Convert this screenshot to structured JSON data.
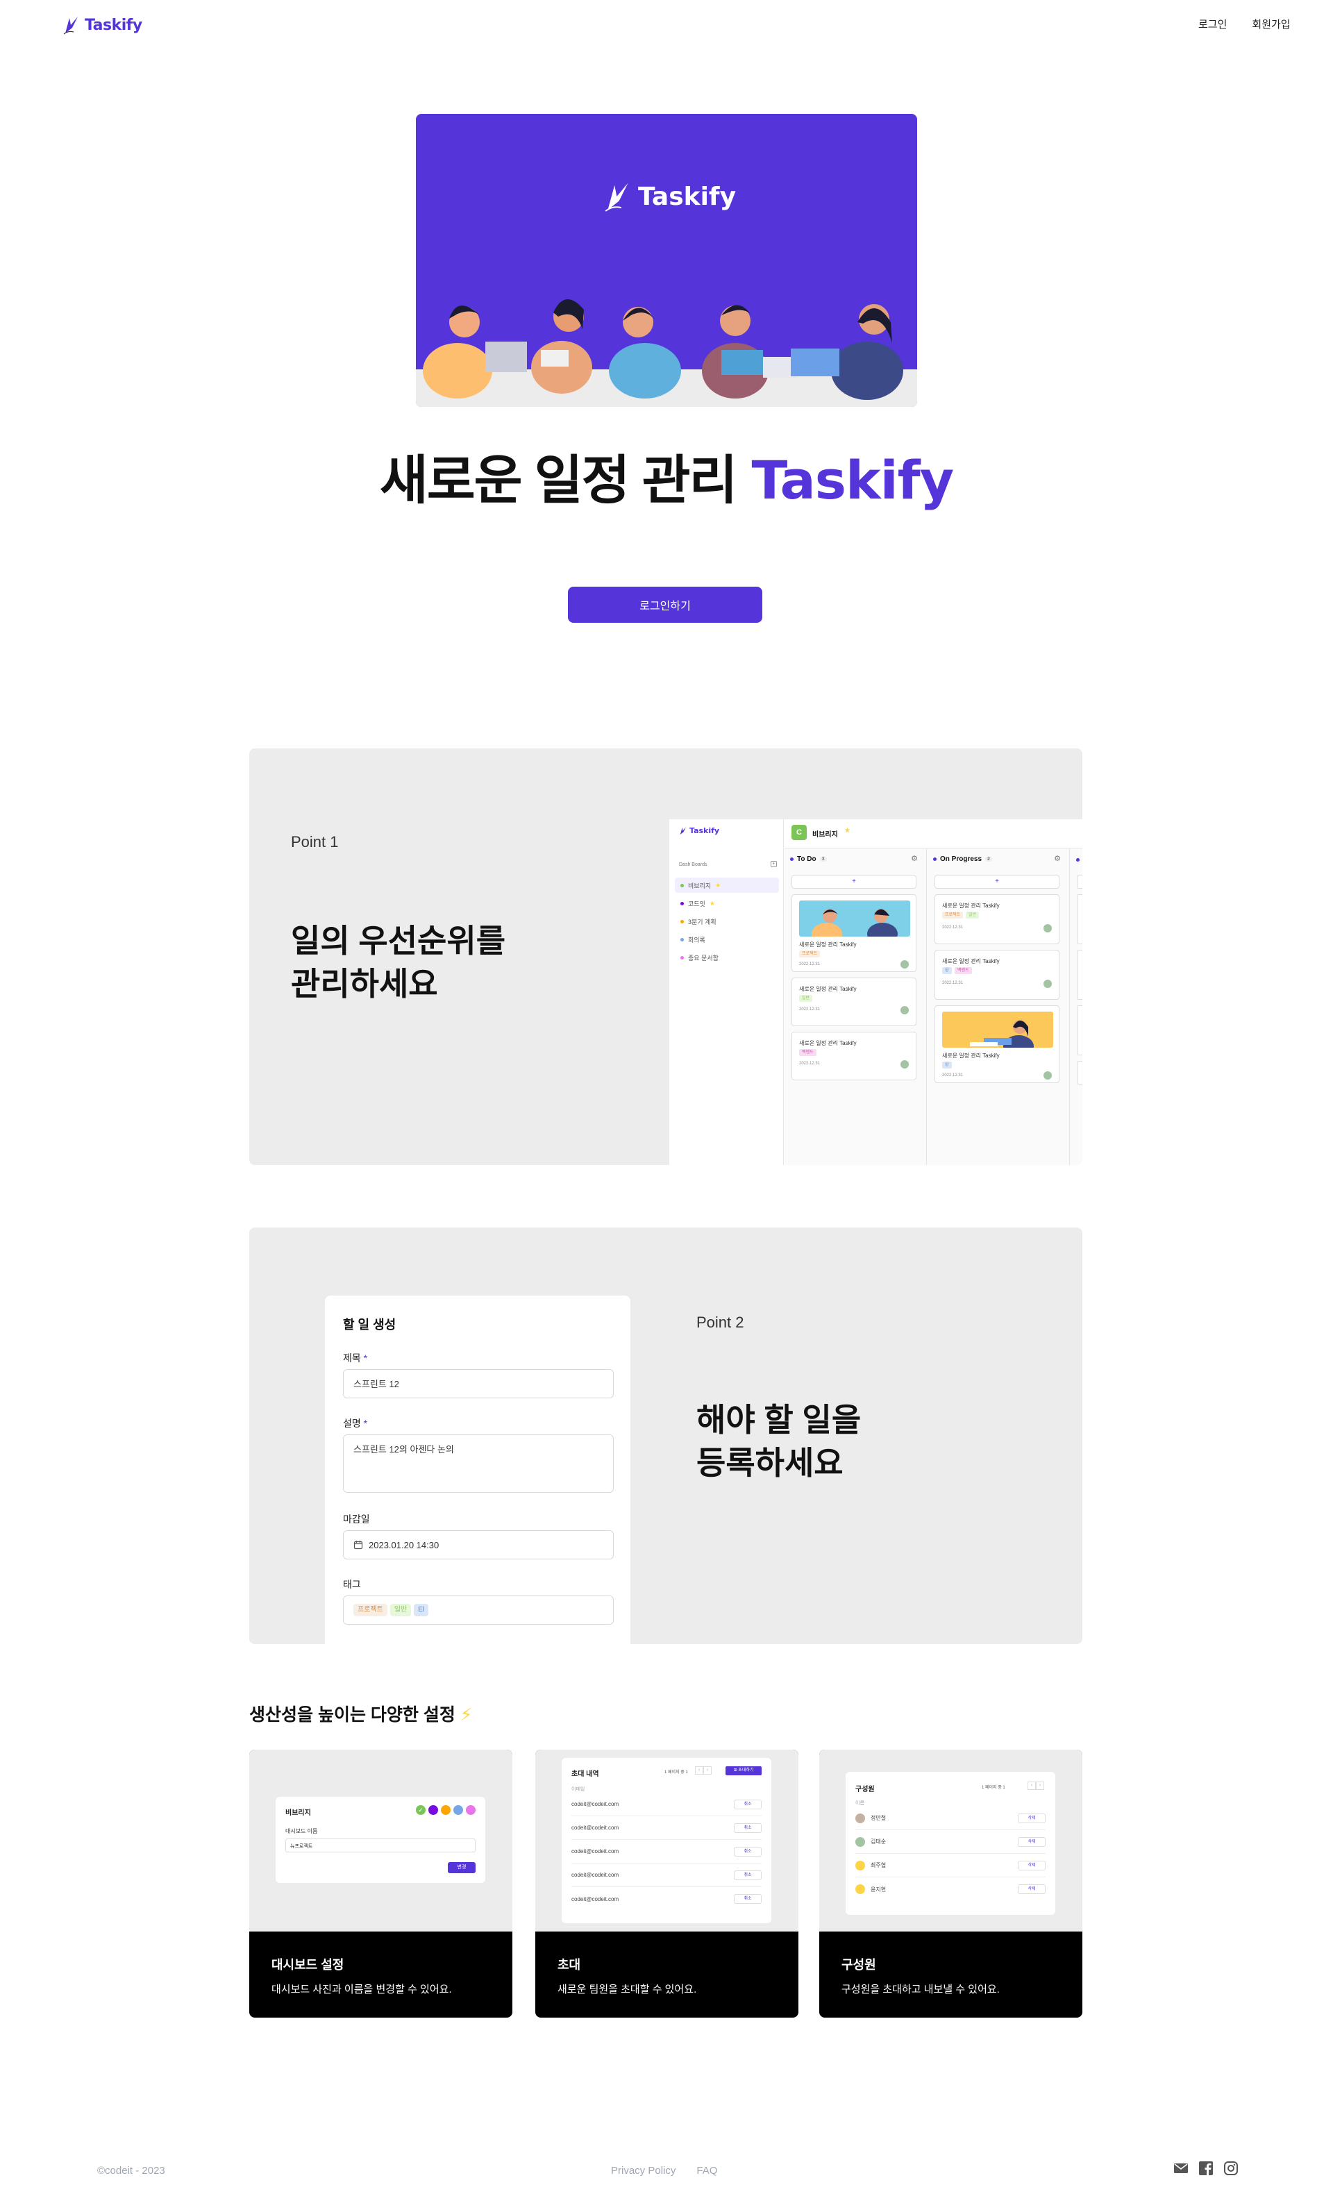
{
  "header": {
    "logo_text": "Taskify",
    "login_link": "로그인",
    "signup_link": "회원가입"
  },
  "hero": {
    "image_logo_text": "Taskify",
    "title_prefix": "새로운 일정 관리",
    "title_brand": "Taskify",
    "login_button": "로그인하기"
  },
  "point1": {
    "label": "Point 1",
    "heading_line1": "일의 우선순위를",
    "heading_line2": "관리하세요",
    "mock": {
      "logo_text": "Taskify",
      "board_title": "비브리지",
      "board_initial": "C",
      "sidebar_heading": "Dash Boards",
      "sidebar_items": [
        {
          "label": "비브리지",
          "color": "#7AC555",
          "active": true
        },
        {
          "label": "코드잇",
          "color": "#760DDE",
          "active": false
        },
        {
          "label": "3분기 계획",
          "color": "#FFA500",
          "active": false
        },
        {
          "label": "회의록",
          "color": "#76A5EA",
          "active": false
        },
        {
          "label": "중요 문서함",
          "color": "#E876EA",
          "active": false
        }
      ],
      "columns": [
        {
          "title": "To Do",
          "count": "3",
          "cards": [
            {
              "title": "새로운 일정 관리 Taskify",
              "tags": [
                "프로젝트"
              ],
              "date": "2022.12.31",
              "has_image": true
            },
            {
              "title": "새로운 일정 관리 Taskify",
              "tags": [
                "일반"
              ],
              "date": "2022.12.31",
              "has_image": false
            },
            {
              "title": "새로운 일정 관리 Taskify",
              "tags": [
                "백엔드"
              ],
              "date": "2022.12.31",
              "has_image": false
            }
          ]
        },
        {
          "title": "On Progress",
          "count": "2",
          "cards": [
            {
              "title": "새로운 일정 관리 Taskify",
              "tags": [
                "프로젝트",
                "일반"
              ],
              "date": "2022.12.31",
              "has_image": false
            },
            {
              "title": "새로운 일정 관리 Taskify",
              "tags": [
                "상",
                "백엔드"
              ],
              "date": "2022.12.31",
              "has_image": false
            },
            {
              "title": "새로운 일정 관리 Taskify",
              "tags": [
                "상"
              ],
              "date": "2022.12.31",
              "has_image": true
            }
          ]
        }
      ],
      "add_symbol": "+"
    }
  },
  "point2": {
    "label": "Point 2",
    "heading_line1": "해야 할 일을",
    "heading_line2": "등록하세요",
    "form": {
      "title": "할 일 생성",
      "title_label": "제목",
      "title_value": "스프린트 12",
      "desc_label": "설명",
      "desc_value": "스프린트 12의 아젠다 논의",
      "due_label": "마감일",
      "due_value": "2023.01.20 14:30",
      "tag_label": "태그",
      "tags": [
        "프로젝트",
        "일반",
        "El"
      ],
      "required_mark": "*"
    }
  },
  "settings": {
    "heading": "생산성을 높이는 다양한 설정",
    "heading_icon": "⚡",
    "cards": [
      {
        "title": "대시보드 설정",
        "desc": "대시보드 사진과 이름을 변경할 수 있어요.",
        "mini": {
          "title": "비브리지",
          "field_label": "대시보드 이름",
          "field_value": "뉴프로젝트",
          "button": "변경",
          "colors": [
            "#7AC555",
            "#760DDE",
            "#FFA500",
            "#76A5EA",
            "#E876EA"
          ]
        }
      },
      {
        "title": "초대",
        "desc": "새로운 팀원을 초대할 수 있어요.",
        "mini": {
          "title": "초대 내역",
          "pager": "1 페이지 중 1",
          "invite_button": "초대하기",
          "col_label": "이메일",
          "rows": [
            "codeit@codeit.com",
            "codeit@codeit.com",
            "codeit@codeit.com",
            "codeit@codeit.com",
            "codeit@codeit.com"
          ],
          "row_button": "취소"
        }
      },
      {
        "title": "구성원",
        "desc": "구성원을 초대하고 내보낼 수 있어요.",
        "mini": {
          "title": "구성원",
          "pager": "1 페이지 중 1",
          "col_label": "이름",
          "rows": [
            "정만철",
            "김태순",
            "최주협",
            "윤지현"
          ],
          "avatar_colors": [
            "#C4B1A2",
            "#A3C4A2",
            "#F4D7DA",
            "#FDD446"
          ],
          "row_button": "삭제"
        }
      }
    ]
  },
  "footer": {
    "copyright": "©codeit - 2023",
    "privacy": "Privacy Policy",
    "faq": "FAQ",
    "icons": [
      "email-icon",
      "facebook-icon",
      "instagram-icon"
    ]
  },
  "colors": {
    "brand": "#5534DA",
    "card_bg": "#ECECEC",
    "text": "#111111"
  }
}
